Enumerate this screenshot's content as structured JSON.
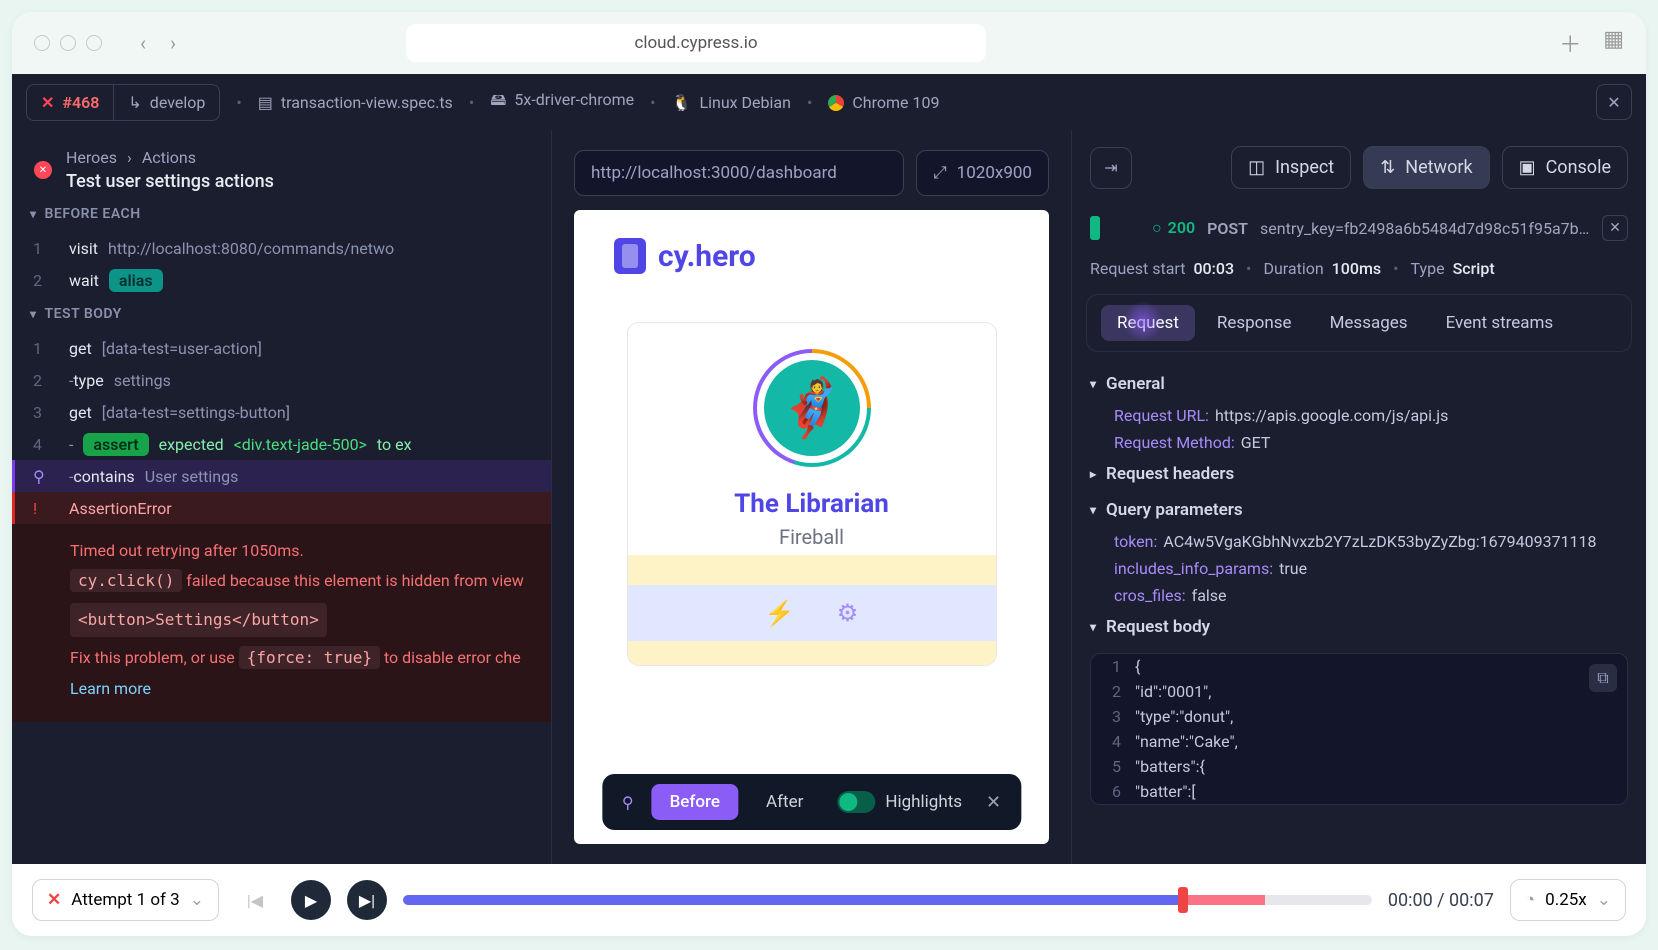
{
  "browser": {
    "url": "cloud.cypress.io"
  },
  "chips": {
    "run_id": "#468",
    "branch": "develop",
    "spec": "transaction-view.spec.ts",
    "driver": "5x-driver-chrome",
    "os": "Linux Debian",
    "browser": "Chrome 109"
  },
  "breadcrumb": {
    "path1": "Heroes",
    "path2": "Actions",
    "title": "Test user settings actions"
  },
  "sections": {
    "before_each": "BEFORE EACH",
    "test_body": "TEST BODY"
  },
  "cmds_before": [
    {
      "n": "1",
      "cmd": "visit",
      "arg": "http://localhost:8080/commands/netwo"
    },
    {
      "n": "2",
      "cmd": "wait",
      "pill": "alias"
    }
  ],
  "cmds_body": [
    {
      "n": "1",
      "cmd": "get",
      "arg": "[data-test=user-action]"
    },
    {
      "n": "2",
      "cmd": "-type",
      "arg": "settings",
      "dash": true
    },
    {
      "n": "3",
      "cmd": "get",
      "arg": "[data-test=settings-button]"
    },
    {
      "n": "4",
      "pill": "assert",
      "tail1": "expected",
      "tail2": "<div.text-jade-500>",
      "tail3": "to ex"
    },
    {
      "pin": "⚲",
      "cmd": "-contains",
      "arg": "User settings",
      "row": "purple"
    },
    {
      "pin": "!",
      "cmd": "AssertionError",
      "row": "red"
    }
  ],
  "error": {
    "l1": "Timed out retrying after 1050ms.",
    "code": "cy.click()",
    "l2": "failed because this element is hidden from view",
    "html": "<button>Settings</button>",
    "l3a": "Fix this problem, or use",
    "force": "{force: true}",
    "l3b": "to disable error che",
    "learn": "Learn more"
  },
  "center": {
    "url": "http://localhost:3000/dashboard",
    "dims": "1020x900",
    "logo": "cy.hero",
    "hero_name": "The Librarian",
    "hero_sub": "Fireball",
    "before": "Before",
    "after": "After",
    "highlights": "Highlights"
  },
  "tools": {
    "inspect": "Inspect",
    "network": "Network",
    "console": "Console"
  },
  "req": {
    "status": "200",
    "method": "POST",
    "name": "sentry_key=fb2498a6b5484d7d98c51f95a7b…"
  },
  "meta": {
    "start_l": "Request start",
    "start_v": "00:03",
    "dur_l": "Duration",
    "dur_v": "100ms",
    "type_l": "Type",
    "type_v": "Script"
  },
  "rtabs": {
    "request": "Request",
    "response": "Response",
    "messages": "Messages",
    "events": "Event streams"
  },
  "detail": {
    "general": "General",
    "url_k": "Request URL:",
    "url_v": "https://apis.google.com/js/api.js",
    "method_k": "Request Method:",
    "method_v": "GET",
    "headers": "Request headers",
    "qparams": "Query parameters",
    "token_k": "token:",
    "token_v": "AC4w5VgaKGbhNvxzb2Y7zLzDK53byZyZbg:1679409371118",
    "iip_k": "includes_info_params:",
    "iip_v": "true",
    "cf_k": "cros_files:",
    "cf_v": "false",
    "body": "Request body"
  },
  "json_body": [
    {
      "n": "1",
      "t": "{"
    },
    {
      "n": "2",
      "t": "   \"id\":\"0001\","
    },
    {
      "n": "3",
      "t": "   \"type\":\"donut\","
    },
    {
      "n": "4",
      "t": "   \"name\":\"Cake\","
    },
    {
      "n": "5",
      "t": "   \"batters\":{"
    },
    {
      "n": "6",
      "t": "      \"batter\":["
    }
  ],
  "footer": {
    "attempt": "Attempt 1 of 3",
    "time": "00:00 / 00:07",
    "speed": "0.25x",
    "progress_blue": 80,
    "progress_red_end": 89
  }
}
